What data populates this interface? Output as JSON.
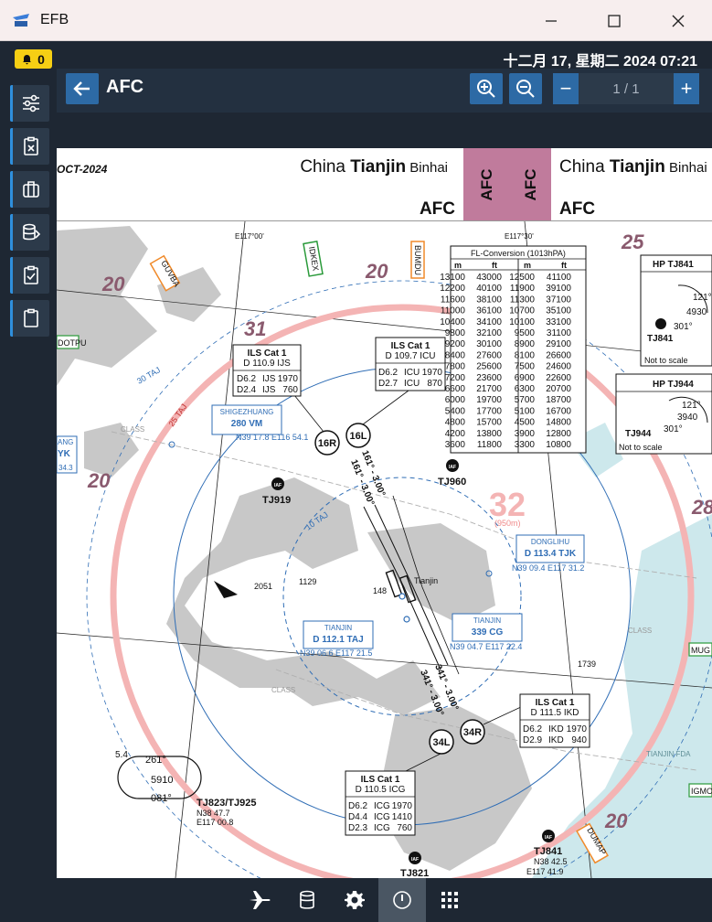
{
  "window": {
    "title": "EFB",
    "minimize": "—",
    "maximize": "☐",
    "close": "✕"
  },
  "notifications": {
    "count": "0"
  },
  "header": {
    "datetime": "十二月 17, 星期二 2024 07:21",
    "title": "AFC",
    "page": "1 / 1",
    "minus": "−",
    "plus": "+"
  },
  "chart": {
    "date_stub": "OCT-2024",
    "left_header": {
      "pre": "China ",
      "bold": "Tianjin",
      "post": " Binhai",
      "code": "AFC"
    },
    "right_header": {
      "pre": "China ",
      "bold": "Tianjin",
      "post": " Binhai",
      "code": "AFC"
    },
    "tab1": "AFC",
    "tab2": "AFC",
    "fl_table": {
      "title": "FL-Conversion (1013hPA)",
      "headers": [
        "m",
        "ft",
        "m",
        "ft"
      ],
      "rows": [
        [
          "13100",
          "43000",
          "12500",
          "41100"
        ],
        [
          "12200",
          "40100",
          "11900",
          "39100"
        ],
        [
          "11600",
          "38100",
          "11300",
          "37100"
        ],
        [
          "11000",
          "36100",
          "10700",
          "35100"
        ],
        [
          "10400",
          "34100",
          "10100",
          "33100"
        ],
        [
          "9800",
          "32100",
          "9500",
          "31100"
        ],
        [
          "9200",
          "30100",
          "8900",
          "29100"
        ],
        [
          "8400",
          "27600",
          "8100",
          "26600"
        ],
        [
          "7800",
          "25600",
          "7500",
          "24600"
        ],
        [
          "7200",
          "23600",
          "6900",
          "22600"
        ],
        [
          "6600",
          "21700",
          "6300",
          "20700"
        ],
        [
          "6000",
          "19700",
          "5700",
          "18700"
        ],
        [
          "5400",
          "17700",
          "5100",
          "16700"
        ],
        [
          "4800",
          "15700",
          "4500",
          "14800"
        ],
        [
          "4200",
          "13800",
          "3900",
          "12800"
        ],
        [
          "3600",
          "11800",
          "3300",
          "10800"
        ]
      ]
    },
    "hp1": {
      "title": "HP TJ841",
      "fix": "TJ841",
      "n1": "121°",
      "n2": "4930",
      "n3": "301°",
      "note": "Not to scale"
    },
    "hp2": {
      "title": "HP TJ944",
      "fix": "TJ944",
      "n1": "121°",
      "n2": "3940",
      "n3": "301°",
      "note": "Not to scale"
    },
    "ils_16r": {
      "title": "ILS Cat 1",
      "line1": "D 110.9 IJS",
      "r1a": "D6.2",
      "r1b": "IJS",
      "r1c": "1970",
      "r2a": "D2.4",
      "r2b": "IJS",
      "r2c": "760"
    },
    "ils_16l": {
      "title": "ILS Cat 1",
      "line1": "D 109.7 ICU",
      "r1a": "D6.2",
      "r1b": "ICU",
      "r1c": "1970",
      "r2a": "D2.7",
      "r2b": "ICU",
      "r2c": "870"
    },
    "ils_34r": {
      "title": "ILS Cat 1",
      "line1": "D 111.5 IKD",
      "r1a": "D6.2",
      "r1b": "IKD",
      "r1c": "1970",
      "r2a": "D2.9",
      "r2b": "IKD",
      "r2c": "940"
    },
    "ils_34l": {
      "title": "ILS Cat 1",
      "line1": "D 110.5 ICG",
      "r1a": "D6.2",
      "r1b": "ICG",
      "r1c": "1970",
      "r2a": "D4.4",
      "r2b": "ICG",
      "r2c": "1410",
      "r3a": "D2.3",
      "r3b": "ICG",
      "r3c": "760"
    },
    "nav_shijiazhuang": {
      "name": "SHIGEZHUANG",
      "freq": "280 VM",
      "coord": "N39 17.8 E116 54.1"
    },
    "nav_donglihu": {
      "name": "DONGLIHU",
      "freq": "D 113.4 TJK",
      "coord": "N39 09.4 E117 31.2"
    },
    "nav_tianjin_taj": {
      "name": "TIANJIN",
      "freq": "D 112.1 TAJ",
      "coord": "N39 06.6 E117 21.5"
    },
    "nav_tianjin_cg": {
      "name": "TIANJIN",
      "freq": "339 CG",
      "coord": "N39 04.7 E117 22.4"
    },
    "runways": {
      "r16r": "16R",
      "r16l": "16L",
      "r34l": "34L",
      "r34r": "34R",
      "c161a": "161° - 3.00°",
      "c161b": "161° - 3.00°",
      "c341a": "341° - 3.00°",
      "c341b": "341° - 3.00°"
    },
    "fixes": {
      "tj919": "TJ919",
      "tj960": "TJ960",
      "tj821": "TJ821",
      "tj841": "TJ841",
      "tj841_n": "N38 42.5",
      "tj841_e": "E117 41.9",
      "tj823": "TJ823/TJ925",
      "tj823_n": "N38 47.7",
      "tj823_e": "E117 00.8",
      "iaf": "IAF"
    },
    "waypoints": {
      "guvba": "GUVBA",
      "idkex": "IDKEX",
      "bumdu": "BUMDU",
      "dumap": "DUMAP",
      "dotpu": "DOTPU",
      "mug": "MUG",
      "igmo": "IGMO"
    },
    "msa": {
      "a": "20",
      "b": "20",
      "c": "20",
      "d": "20",
      "e": "20",
      "f": "31",
      "g": "25",
      "h": "28",
      "big": "32",
      "big_sub": "(950m)"
    },
    "misc": {
      "e117_00": "E117°00'",
      "e117_30": "E117°30'",
      "taj30": "30 TAJ",
      "taj25": "25 TAJ",
      "taj10": "10 TAJ",
      "city": "Tianjin",
      "elev2051": "2051",
      "elev1129": "1129",
      "elev148": "148",
      "elev1739": "1739",
      "fda": "TIANJIN FDA",
      "hold_a": "261°",
      "hold_b": "081°",
      "hold_c": "5910",
      "hold_d": "5.4",
      "yk": "YK",
      "yk_c": "34.3",
      "ang": "ANG",
      "class1": "CLASS",
      "class2": "CLASS",
      "class3": "CLASS"
    }
  },
  "colors": {
    "accent": "#2d6aa5",
    "bell": "#f6cf14",
    "magenta_tab": "#c07b9c",
    "msa": "#8a5a6e"
  }
}
